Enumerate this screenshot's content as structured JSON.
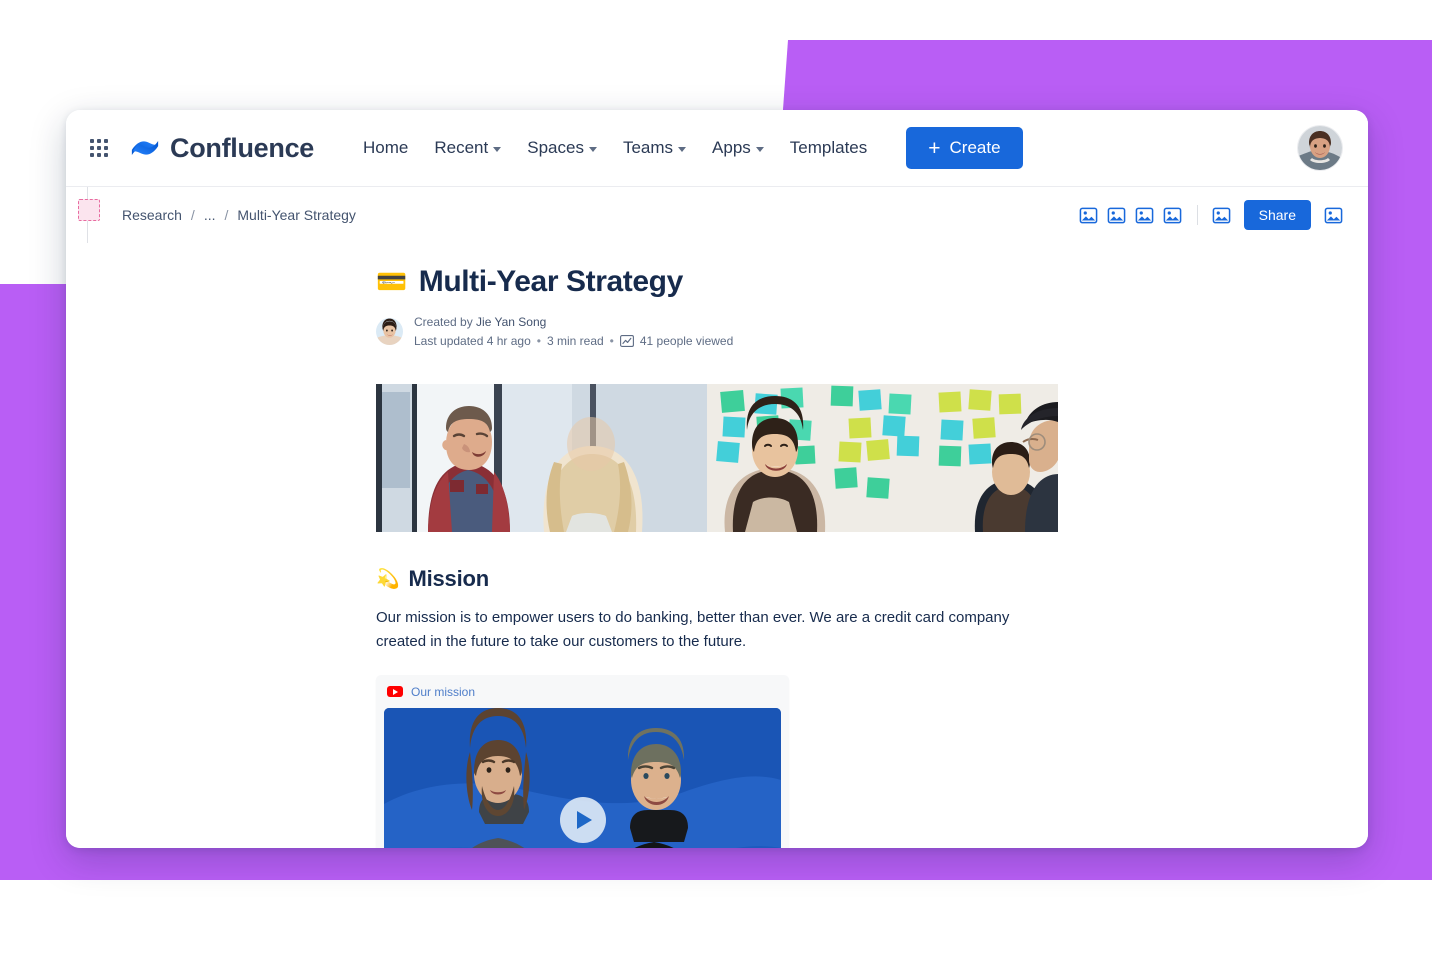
{
  "theme": {
    "accent_purple": "#b95ef5",
    "brand_blue": "#1868db",
    "text_dark": "#172b4d",
    "text_muted": "#5e6c84"
  },
  "topnav": {
    "apps_icon": "apps-grid-icon",
    "logo_icon": "confluence-logo-icon",
    "product_name": "Confluence",
    "links": [
      {
        "label": "Home",
        "has_caret": false
      },
      {
        "label": "Recent",
        "has_caret": true
      },
      {
        "label": "Spaces",
        "has_caret": true
      },
      {
        "label": "Teams",
        "has_caret": true
      },
      {
        "label": "Apps",
        "has_caret": true
      },
      {
        "label": "Templates",
        "has_caret": false
      }
    ],
    "create_button": {
      "label": "Create",
      "icon": "plus-icon"
    },
    "avatar_alt": "user-avatar"
  },
  "breadcrumb": {
    "space_thumb_icon": "space-thumbnail-placeholder-icon",
    "items": [
      {
        "label": "Research",
        "current": false
      },
      {
        "label": "...",
        "current": false
      },
      {
        "label": "Multi-Year Strategy",
        "current": true
      }
    ],
    "separator": "/"
  },
  "page_actions": {
    "icons": [
      "image-placeholder-icon",
      "image-placeholder-icon",
      "image-placeholder-icon",
      "image-placeholder-icon"
    ],
    "divider": true,
    "icon_after_divider": "image-placeholder-icon",
    "share_label": "Share",
    "trailing_icon": "image-placeholder-icon"
  },
  "document": {
    "emoji": "💳",
    "emoji_name": "credit-card-emoji",
    "title": "Multi-Year Strategy",
    "byline": {
      "created_prefix": "Created by",
      "author": "Jie Yan Song",
      "last_updated": "Last updated 4 hr ago",
      "read_time": "3 min read",
      "views": "41 people viewed",
      "views_icon": "analytics-chart-icon",
      "separator": "•"
    },
    "hero": {
      "name": "hero-image",
      "left_alt": "two-colleagues-talking-photo",
      "right_alt": "woman-at-sticky-note-wall-photo"
    },
    "sections": [
      {
        "emoji": "💫",
        "emoji_name": "comet-emoji",
        "heading": "Mission",
        "paragraph": "Our mission is to empower users to do banking, better than ever. We are a credit card company created in the future to take our customers to the future."
      }
    ],
    "embed": {
      "source_icon": "youtube-icon",
      "label": "Our mission",
      "video_alt": "two-founders-on-blue-background-video-thumbnail",
      "play_icon": "play-button-icon"
    }
  }
}
